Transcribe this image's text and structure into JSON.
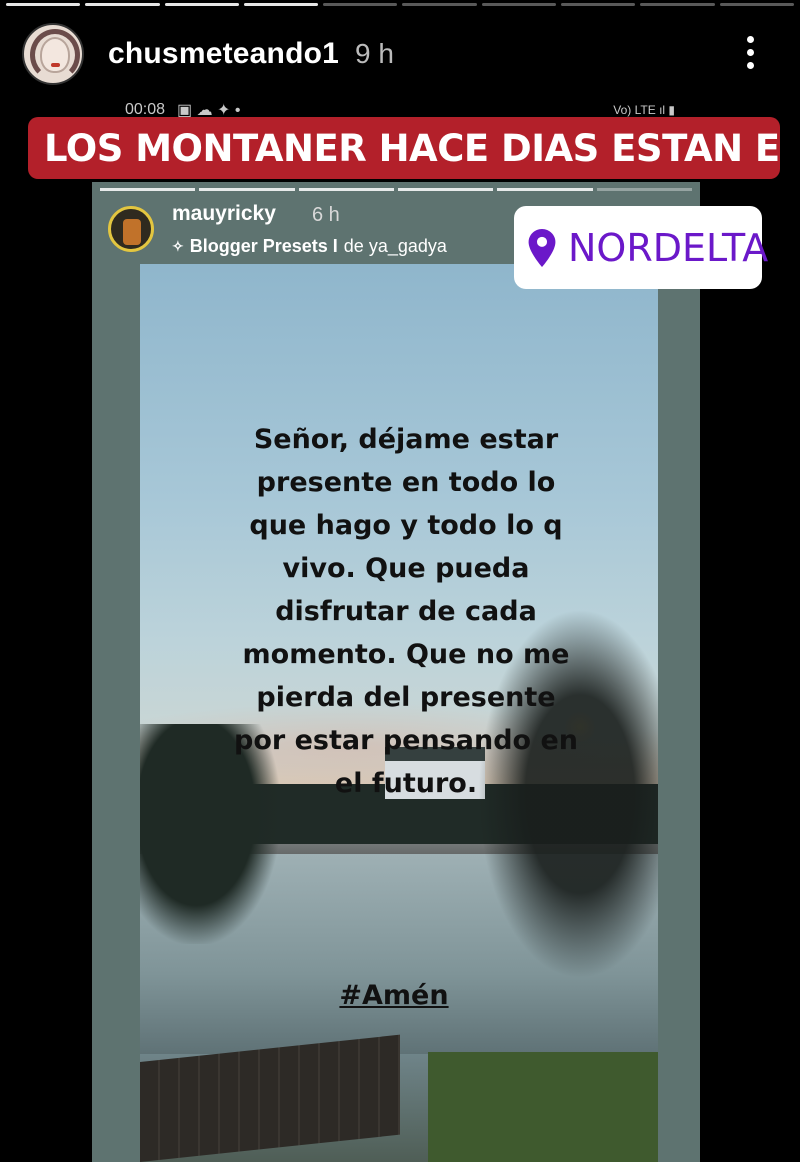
{
  "story": {
    "progress_done": 4,
    "progress_total": 10,
    "username": "chusmeteando1",
    "time_ago": "9 h",
    "more_icon": "more-vertical-icon"
  },
  "status_bar": {
    "time": "00:08",
    "icons_left": "▣ ☁ ✦ •",
    "icons_right": "Vo) LTE ıl ▮"
  },
  "banner": {
    "text": "LOS MONTANER HACE DIAS ESTAN EN",
    "flag_icon": "argentina-flag-icon",
    "color": "#b3202a"
  },
  "location_sticker": {
    "label": "NORDELTA",
    "pin_icon": "location-pin-icon",
    "color": "#6b18c9"
  },
  "inner_story": {
    "username": "mauyricky",
    "time_ago": "6 h",
    "preset_label": "Blogger Presets I",
    "preset_author": "de ya_gadya",
    "quote": "Señor, déjame estar\npresente en todo lo\nque hago y todo lo q\nvivo. Que pueda\ndisfrutar de cada\nmomento. Que no me\npierda del presente\npor estar pensando en\nel futuro.",
    "hashtag": "#Amén"
  }
}
